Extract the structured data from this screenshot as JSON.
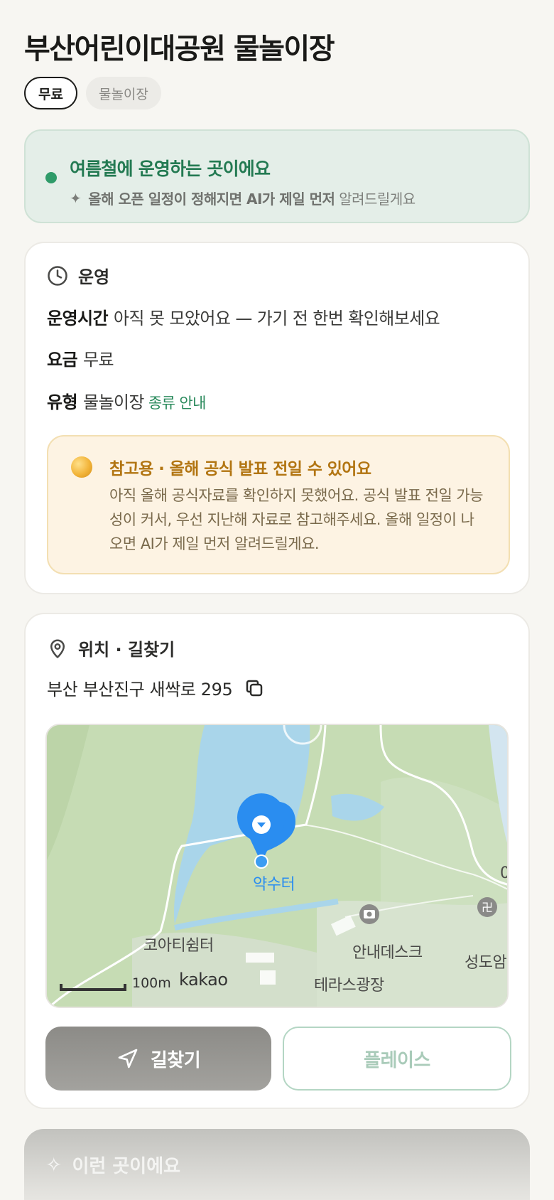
{
  "header": {
    "title": "부산어린이대공원 물놀이장",
    "chips": [
      "무료",
      "물놀이장"
    ]
  },
  "notice": {
    "headline": "여름철에 운영하는 곳이에요",
    "sub_strong": "올해 오픈 일정이 정해지면 AI가 제일 먼저",
    "sub_rest": "알려드릴게요",
    "status_color": "#2f9b69"
  },
  "operation": {
    "section_title": "운영",
    "hours_label": "운영시간",
    "hours_value": "아직 못 모았어요 — 가기 전 한번 확인해보세요",
    "fee_label": "요금",
    "fee_value": "무료",
    "type_label": "유형",
    "type_value": "물놀이장",
    "type_link": "종류 안내",
    "warning": {
      "title": "참고용 · 올해 공식 발표 전일 수 있어요",
      "body": "아직 올해 공식자료를 확인하지 못했어요. 공식 발표 전일 가능성이 커서, 우선 지난해 자료로 참고해주세요. 올해 일정이 나오면 AI가 제일 먼저 알려드릴게요."
    }
  },
  "location": {
    "section_title": "위치 · 길찾기",
    "address": "부산 부산진구 새싹로 295",
    "map": {
      "labels": {
        "pin": "약수터",
        "coati": "코아티쉼터",
        "info": "안내데스크",
        "temple": "성도암",
        "terrace": "테라스광장",
        "edge": "0"
      },
      "scale": "100m",
      "provider": "kakao"
    },
    "route_button": "길찾기",
    "place_button": "플레이스"
  },
  "next_section": {
    "title": "이런 곳이에요"
  }
}
